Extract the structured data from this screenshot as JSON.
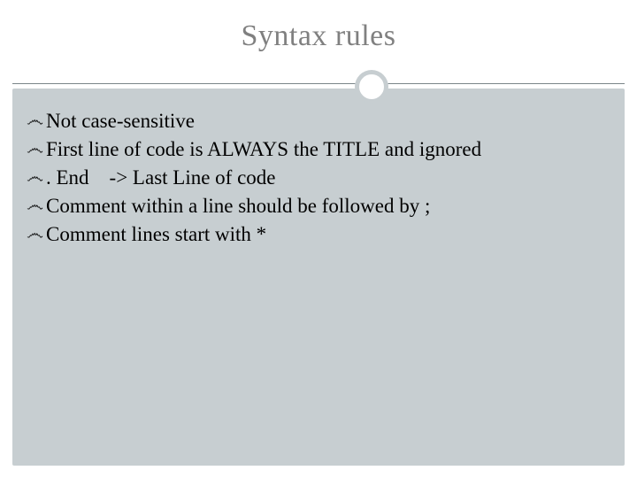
{
  "title": "Syntax rules",
  "bullet_glyph": "෴",
  "items": [
    "Not case-sensitive",
    "First line of code is ALWAYS the TITLE and ignored",
    ". End -> Last Line of code",
    "Comment within a line should be followed by ;",
    "Comment lines start with *"
  ]
}
